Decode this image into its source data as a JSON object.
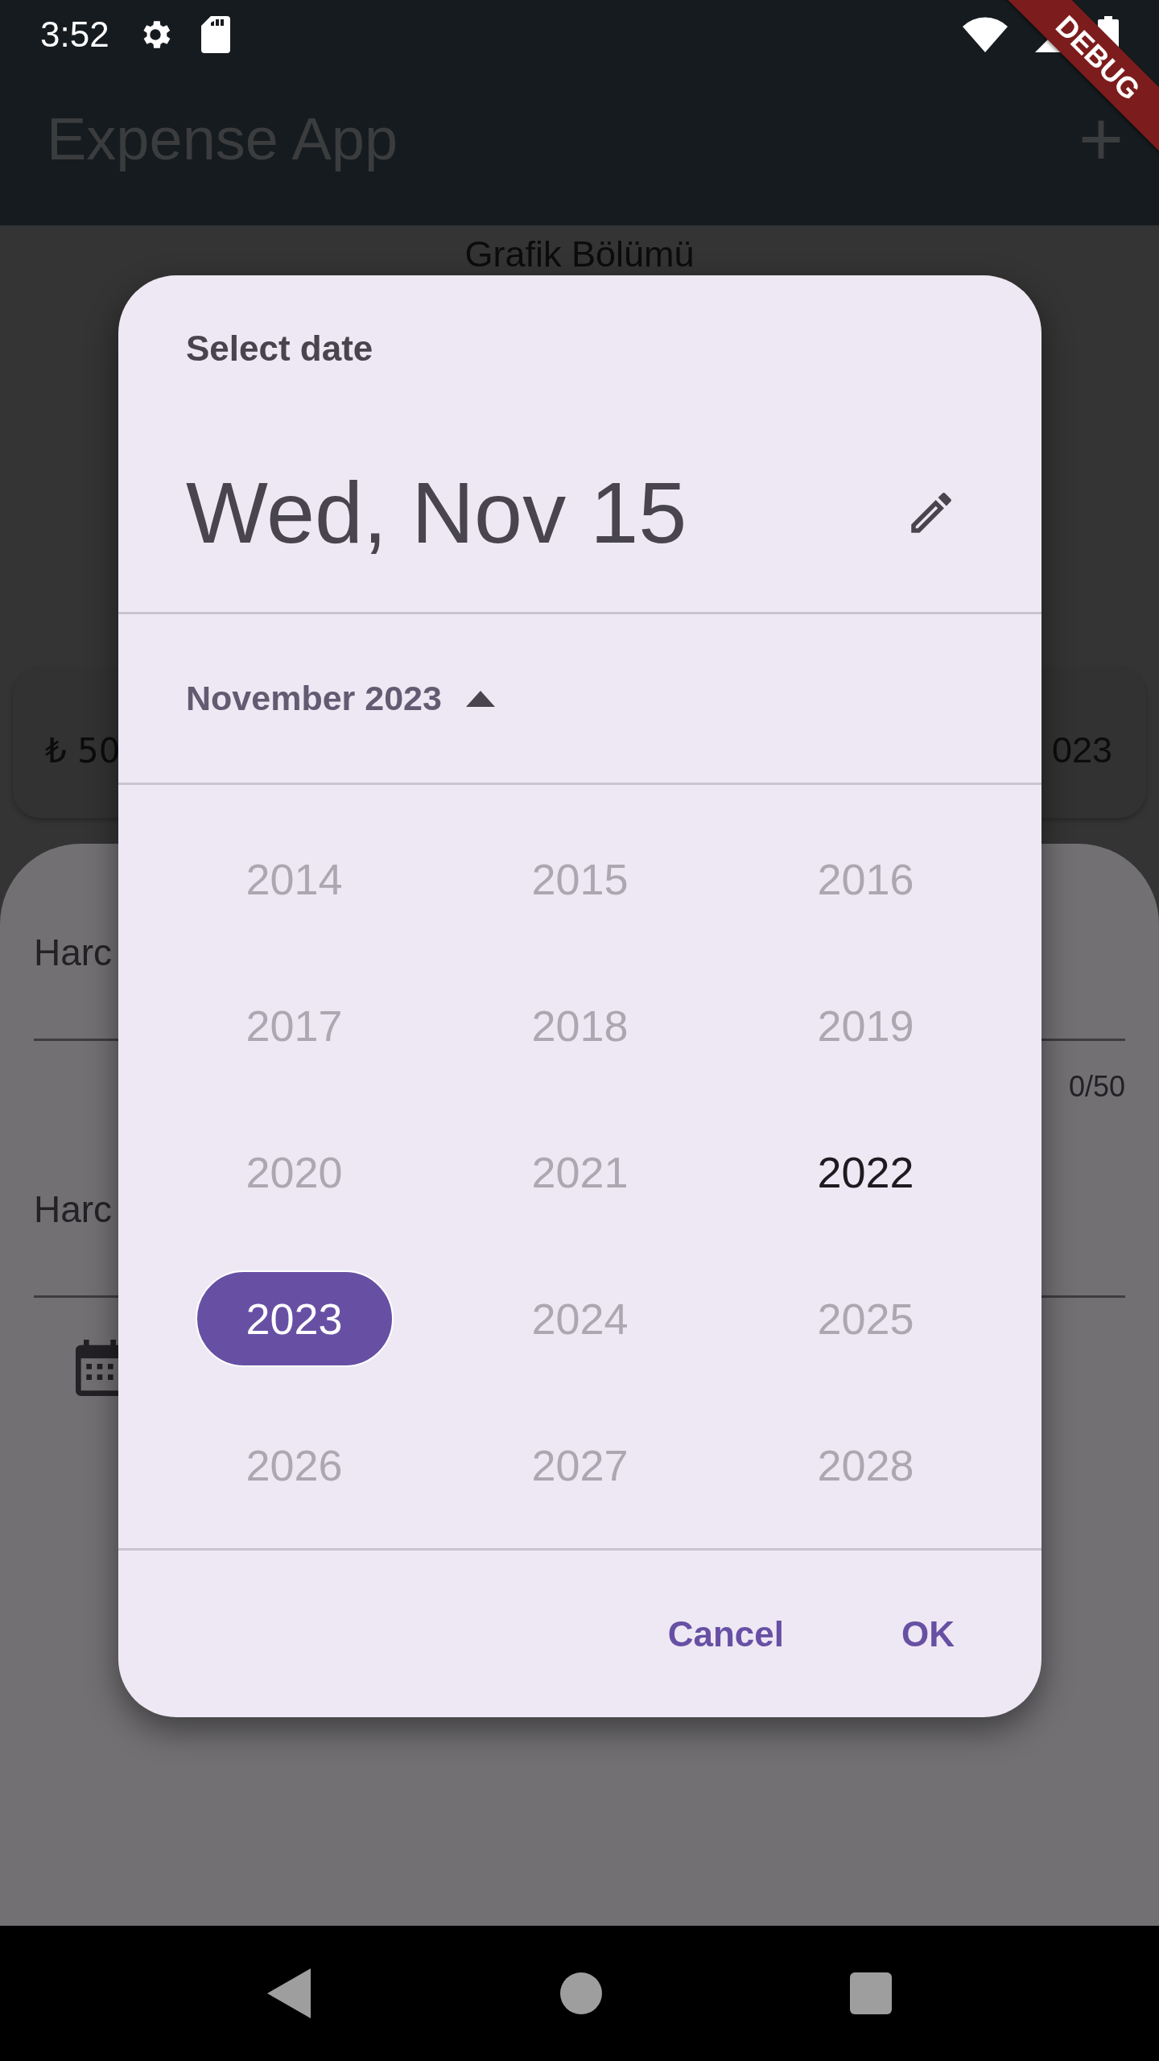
{
  "status_bar": {
    "time": "3:52"
  },
  "debug_banner": {
    "label": "DEBUG"
  },
  "app_bar": {
    "title": "Expense App",
    "action": "+"
  },
  "chart_section": {
    "title": "Grafik Bölümü"
  },
  "expense_card": {
    "amount": "₺ 50",
    "date": "023"
  },
  "form_sheet": {
    "fields": [
      {
        "label": "Harc",
        "counter": "0/50"
      },
      {
        "label": "Harc"
      }
    ]
  },
  "date_picker": {
    "header": "Select date",
    "selected_date": "Wed, Nov 15",
    "month_label": "November 2023",
    "years": [
      {
        "label": "2014",
        "selected": false,
        "disabled": true
      },
      {
        "label": "2015",
        "selected": false,
        "disabled": true
      },
      {
        "label": "2016",
        "selected": false,
        "disabled": true
      },
      {
        "label": "2017",
        "selected": false,
        "disabled": true
      },
      {
        "label": "2018",
        "selected": false,
        "disabled": true
      },
      {
        "label": "2019",
        "selected": false,
        "disabled": true
      },
      {
        "label": "2020",
        "selected": false,
        "disabled": true
      },
      {
        "label": "2021",
        "selected": false,
        "disabled": true
      },
      {
        "label": "2022",
        "selected": false,
        "disabled": false
      },
      {
        "label": "2023",
        "selected": true,
        "disabled": false
      },
      {
        "label": "2024",
        "selected": false,
        "disabled": true
      },
      {
        "label": "2025",
        "selected": false,
        "disabled": true
      },
      {
        "label": "2026",
        "selected": false,
        "disabled": true
      },
      {
        "label": "2027",
        "selected": false,
        "disabled": true
      },
      {
        "label": "2028",
        "selected": false,
        "disabled": true
      }
    ],
    "buttons": [
      "Cancel",
      "OK"
    ]
  }
}
